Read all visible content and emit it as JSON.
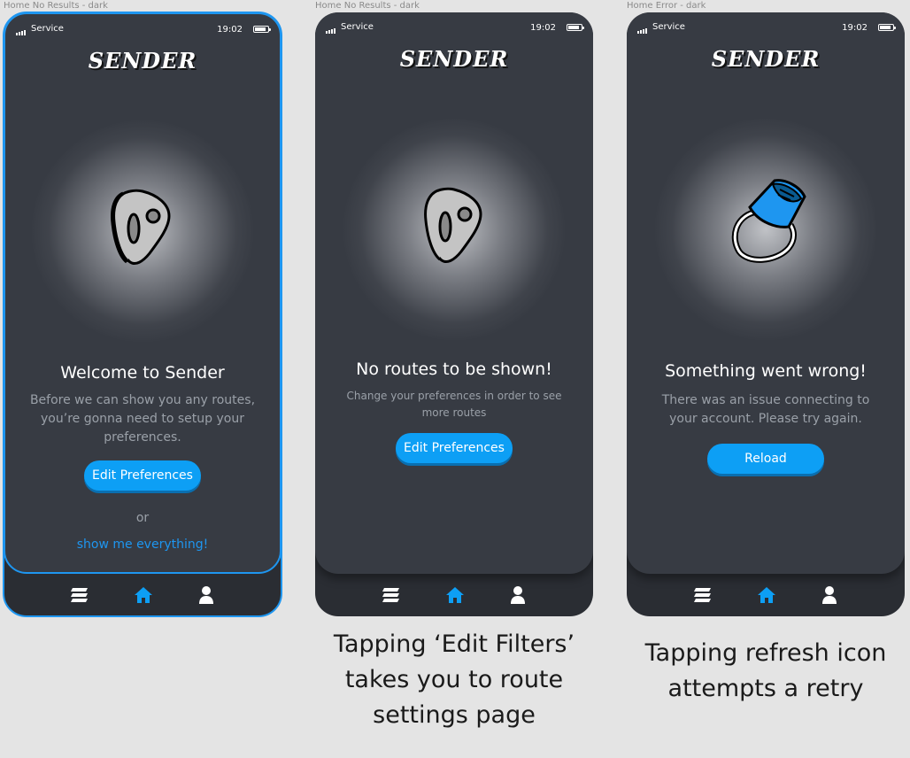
{
  "frames": [
    {
      "label": "Home No Results - dark",
      "status": {
        "carrier": "Service",
        "time": "19:02"
      },
      "logo": "SENDER",
      "title": "Welcome to Sender",
      "description": "Before we can show you any routes, you’re gonna need to setup your preferences.",
      "button": "Edit Preferences",
      "or_text": "or",
      "link": "show me everything!",
      "illustration": "climbing-hold-icon"
    },
    {
      "label": "Home No Results - dark",
      "status": {
        "carrier": "Service",
        "time": "19:02"
      },
      "logo": "SENDER",
      "title": "No routes to be shown!",
      "description": "Change your preferences in order to see more routes",
      "button": "Edit Preferences",
      "illustration": "climbing-hold-icon",
      "caption": "Tapping ‘Edit Filters’ takes you to route settings page"
    },
    {
      "label": "Home Error - dark",
      "status": {
        "carrier": "Service",
        "time": "19:02"
      },
      "logo": "SENDER",
      "title": "Something went wrong!",
      "description": "There was an issue connecting to your account. Please try again.",
      "button": "Reload",
      "illustration": "chalk-bag-icon",
      "caption": "Tapping refresh icon attempts a retry"
    }
  ],
  "tabbar": {
    "items": [
      "stack-icon",
      "home-icon",
      "profile-icon"
    ],
    "active": "home-icon"
  },
  "colors": {
    "accent": "#0d9ff5",
    "screen": "#373b43",
    "tabbar": "#2a2d33",
    "link": "#1e96f0"
  }
}
